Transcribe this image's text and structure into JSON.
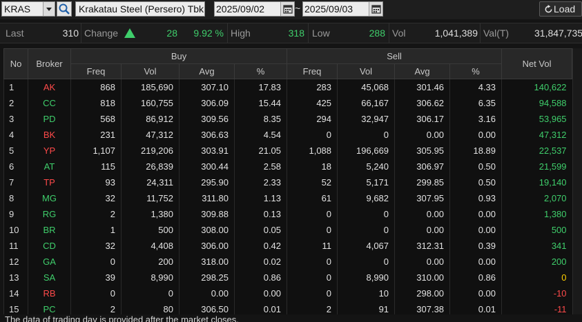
{
  "toolbar": {
    "ticker": "KRAS",
    "company_name": "Krakatau Steel (Persero) Tbk.",
    "date_from": "2025/09/02",
    "date_separator": "~",
    "date_to": "2025/09/03",
    "load_label": "Load"
  },
  "quote": {
    "last_label": "Last",
    "last_value": "310",
    "change_label": "Change",
    "change_value": "28",
    "change_pct": "9.92 %",
    "high_label": "High",
    "high_value": "318",
    "low_label": "Low",
    "low_value": "288",
    "vol_label": "Vol",
    "vol_value": "1,041,389",
    "valt_label": "Val(T)",
    "valt_value": "31,847,735"
  },
  "colors": {
    "up": "#3fce6b",
    "down": "#ff4a4a",
    "neutral": "#ffd000"
  },
  "table": {
    "headers": {
      "no": "No",
      "broker": "Broker",
      "buy": "Buy",
      "sell": "Sell",
      "net_vol": "Net Vol",
      "buy_freq": "Freq",
      "buy_vol": "Vol",
      "buy_avg": "Avg",
      "buy_pct": "%",
      "sell_freq": "Freq",
      "sell_vol": "Vol",
      "sell_avg": "Avg",
      "sell_pct": "%"
    },
    "rows": [
      {
        "no": "1",
        "broker": "AK",
        "bc": "red",
        "bf": "868",
        "bv": "185,690",
        "ba": "307.10",
        "bp": "17.83",
        "sf": "283",
        "sv": "45,068",
        "sa": "301.46",
        "sp": "4.33",
        "net": "140,622",
        "nc": "grn"
      },
      {
        "no": "2",
        "broker": "CC",
        "bc": "grn",
        "bf": "818",
        "bv": "160,755",
        "ba": "306.09",
        "bp": "15.44",
        "sf": "425",
        "sv": "66,167",
        "sa": "306.62",
        "sp": "6.35",
        "net": "94,588",
        "nc": "grn"
      },
      {
        "no": "3",
        "broker": "PD",
        "bc": "grn",
        "bf": "568",
        "bv": "86,912",
        "ba": "309.56",
        "bp": "8.35",
        "sf": "294",
        "sv": "32,947",
        "sa": "306.17",
        "sp": "3.16",
        "net": "53,965",
        "nc": "grn"
      },
      {
        "no": "4",
        "broker": "BK",
        "bc": "red",
        "bf": "231",
        "bv": "47,312",
        "ba": "306.63",
        "bp": "4.54",
        "sf": "0",
        "sv": "0",
        "sa": "0.00",
        "sp": "0.00",
        "net": "47,312",
        "nc": "grn"
      },
      {
        "no": "5",
        "broker": "YP",
        "bc": "red",
        "bf": "1,107",
        "bv": "219,206",
        "ba": "303.91",
        "bp": "21.05",
        "sf": "1,088",
        "sv": "196,669",
        "sa": "305.95",
        "sp": "18.89",
        "net": "22,537",
        "nc": "grn"
      },
      {
        "no": "6",
        "broker": "AT",
        "bc": "grn",
        "bf": "115",
        "bv": "26,839",
        "ba": "300.44",
        "bp": "2.58",
        "sf": "18",
        "sv": "5,240",
        "sa": "306.97",
        "sp": "0.50",
        "net": "21,599",
        "nc": "grn"
      },
      {
        "no": "7",
        "broker": "TP",
        "bc": "red",
        "bf": "93",
        "bv": "24,311",
        "ba": "295.90",
        "bp": "2.33",
        "sf": "52",
        "sv": "5,171",
        "sa": "299.85",
        "sp": "0.50",
        "net": "19,140",
        "nc": "grn"
      },
      {
        "no": "8",
        "broker": "MG",
        "bc": "grn",
        "bf": "32",
        "bv": "11,752",
        "ba": "311.80",
        "bp": "1.13",
        "sf": "61",
        "sv": "9,682",
        "sa": "307.95",
        "sp": "0.93",
        "net": "2,070",
        "nc": "grn"
      },
      {
        "no": "9",
        "broker": "RG",
        "bc": "grn",
        "bf": "2",
        "bv": "1,380",
        "ba": "309.88",
        "bp": "0.13",
        "sf": "0",
        "sv": "0",
        "sa": "0.00",
        "sp": "0.00",
        "net": "1,380",
        "nc": "grn"
      },
      {
        "no": "10",
        "broker": "BR",
        "bc": "grn",
        "bf": "1",
        "bv": "500",
        "ba": "308.00",
        "bp": "0.05",
        "sf": "0",
        "sv": "0",
        "sa": "0.00",
        "sp": "0.00",
        "net": "500",
        "nc": "grn"
      },
      {
        "no": "11",
        "broker": "CD",
        "bc": "grn",
        "bf": "32",
        "bv": "4,408",
        "ba": "306.00",
        "bp": "0.42",
        "sf": "11",
        "sv": "4,067",
        "sa": "312.31",
        "sp": "0.39",
        "net": "341",
        "nc": "grn"
      },
      {
        "no": "12",
        "broker": "GA",
        "bc": "grn",
        "bf": "0",
        "bv": "200",
        "ba": "318.00",
        "bp": "0.02",
        "sf": "0",
        "sv": "0",
        "sa": "0.00",
        "sp": "0.00",
        "net": "200",
        "nc": "grn"
      },
      {
        "no": "13",
        "broker": "SA",
        "bc": "grn",
        "bf": "39",
        "bv": "8,990",
        "ba": "298.25",
        "bp": "0.86",
        "sf": "0",
        "sv": "8,990",
        "sa": "310.00",
        "sp": "0.86",
        "net": "0",
        "nc": "yel"
      },
      {
        "no": "14",
        "broker": "RB",
        "bc": "red",
        "bf": "0",
        "bv": "0",
        "ba": "0.00",
        "bp": "0.00",
        "sf": "0",
        "sv": "10",
        "sa": "298.00",
        "sp": "0.00",
        "net": "-10",
        "nc": "red"
      },
      {
        "no": "15",
        "broker": "PC",
        "bc": "grn",
        "bf": "2",
        "bv": "80",
        "ba": "306.50",
        "bp": "0.01",
        "sf": "2",
        "sv": "91",
        "sa": "307.38",
        "sp": "0.01",
        "net": "-11",
        "nc": "red"
      }
    ]
  },
  "footer": {
    "notice": "The data of trading day is provided after the market closes."
  }
}
